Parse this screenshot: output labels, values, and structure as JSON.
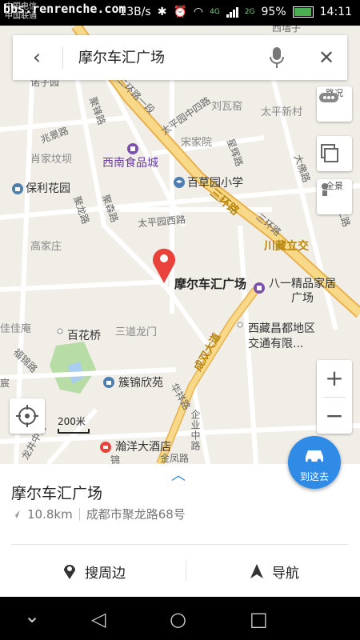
{
  "status": {
    "watermark": "bbs.renrenche.com",
    "carrier_1": "中国电信",
    "carrier_2": "中国联通",
    "speed": "13B/s",
    "net_1": "4G",
    "net_2": "2G",
    "battery": "95%",
    "battery_level": 0.95,
    "time": "14:11"
  },
  "search": {
    "query": "摩尔车汇广场"
  },
  "map": {
    "labels": {
      "west_cang_top": "西墙子",
      "nuoziyuan": "诺子园",
      "xierhuan": "西二环路一段",
      "taipingyuan_zhong": "太平园中四路",
      "liuwayao": "刘瓦窑",
      "taiping_xincun": "太平新村",
      "jufeng": "聚锋路",
      "zhaoyuan": "兆景路",
      "xiaojiazi": "肖家坟坝",
      "xinan_shipin": "西南食品城",
      "songjiayuan": "宋家院",
      "xingbei": "星辉路",
      "dafo": "大佛路",
      "baoli": "保利花园",
      "baicaoyuan": "百草园小学",
      "sanhuan_lu": "三环路",
      "sanhuan_lu2": "三环路",
      "huanlong": "聚龙路",
      "jubei": "聚森路",
      "taipingyuan_xi": "太平园西路",
      "gaojiazhuang": "高家庄",
      "chuanzang": "川藏立交",
      "nanqiao": "南桥二路",
      "quanjing_road": "大件路",
      "moer": "摩尔车汇广场",
      "bayi_1": "八一精品家居",
      "bayi_2": "广场",
      "jiaan": "佳佳庵",
      "baihuaqiao": "百花桥",
      "sandao": "三道龙门",
      "xizang_1": "西藏昌都地区",
      "xizang_2": "交通有限...",
      "chengshuang": "成双大道",
      "fujin": "福锦路",
      "jinjin": "簇锦欣苑",
      "huaxuan": "华祥路",
      "qiye": "企业中路",
      "longjing": "龙井中街",
      "hanyang": "瀚洋大酒店",
      "jixiao": "金凤路",
      "zhongting": "宸",
      "jinwan": "锦"
    },
    "ctrl_traffic": "路况",
    "ctrl_street": "全景",
    "scale": "200米"
  },
  "route_button": "到这去",
  "place": {
    "name": "摩尔车汇广场",
    "distance": "10.8km",
    "address": "成都市聚龙路68号"
  },
  "actions": {
    "nearby": "搜周边",
    "navigate": "导航"
  },
  "colors": {
    "accent": "#2f8be6",
    "ring_road": "#f6c667",
    "marker": "#e8423a"
  }
}
